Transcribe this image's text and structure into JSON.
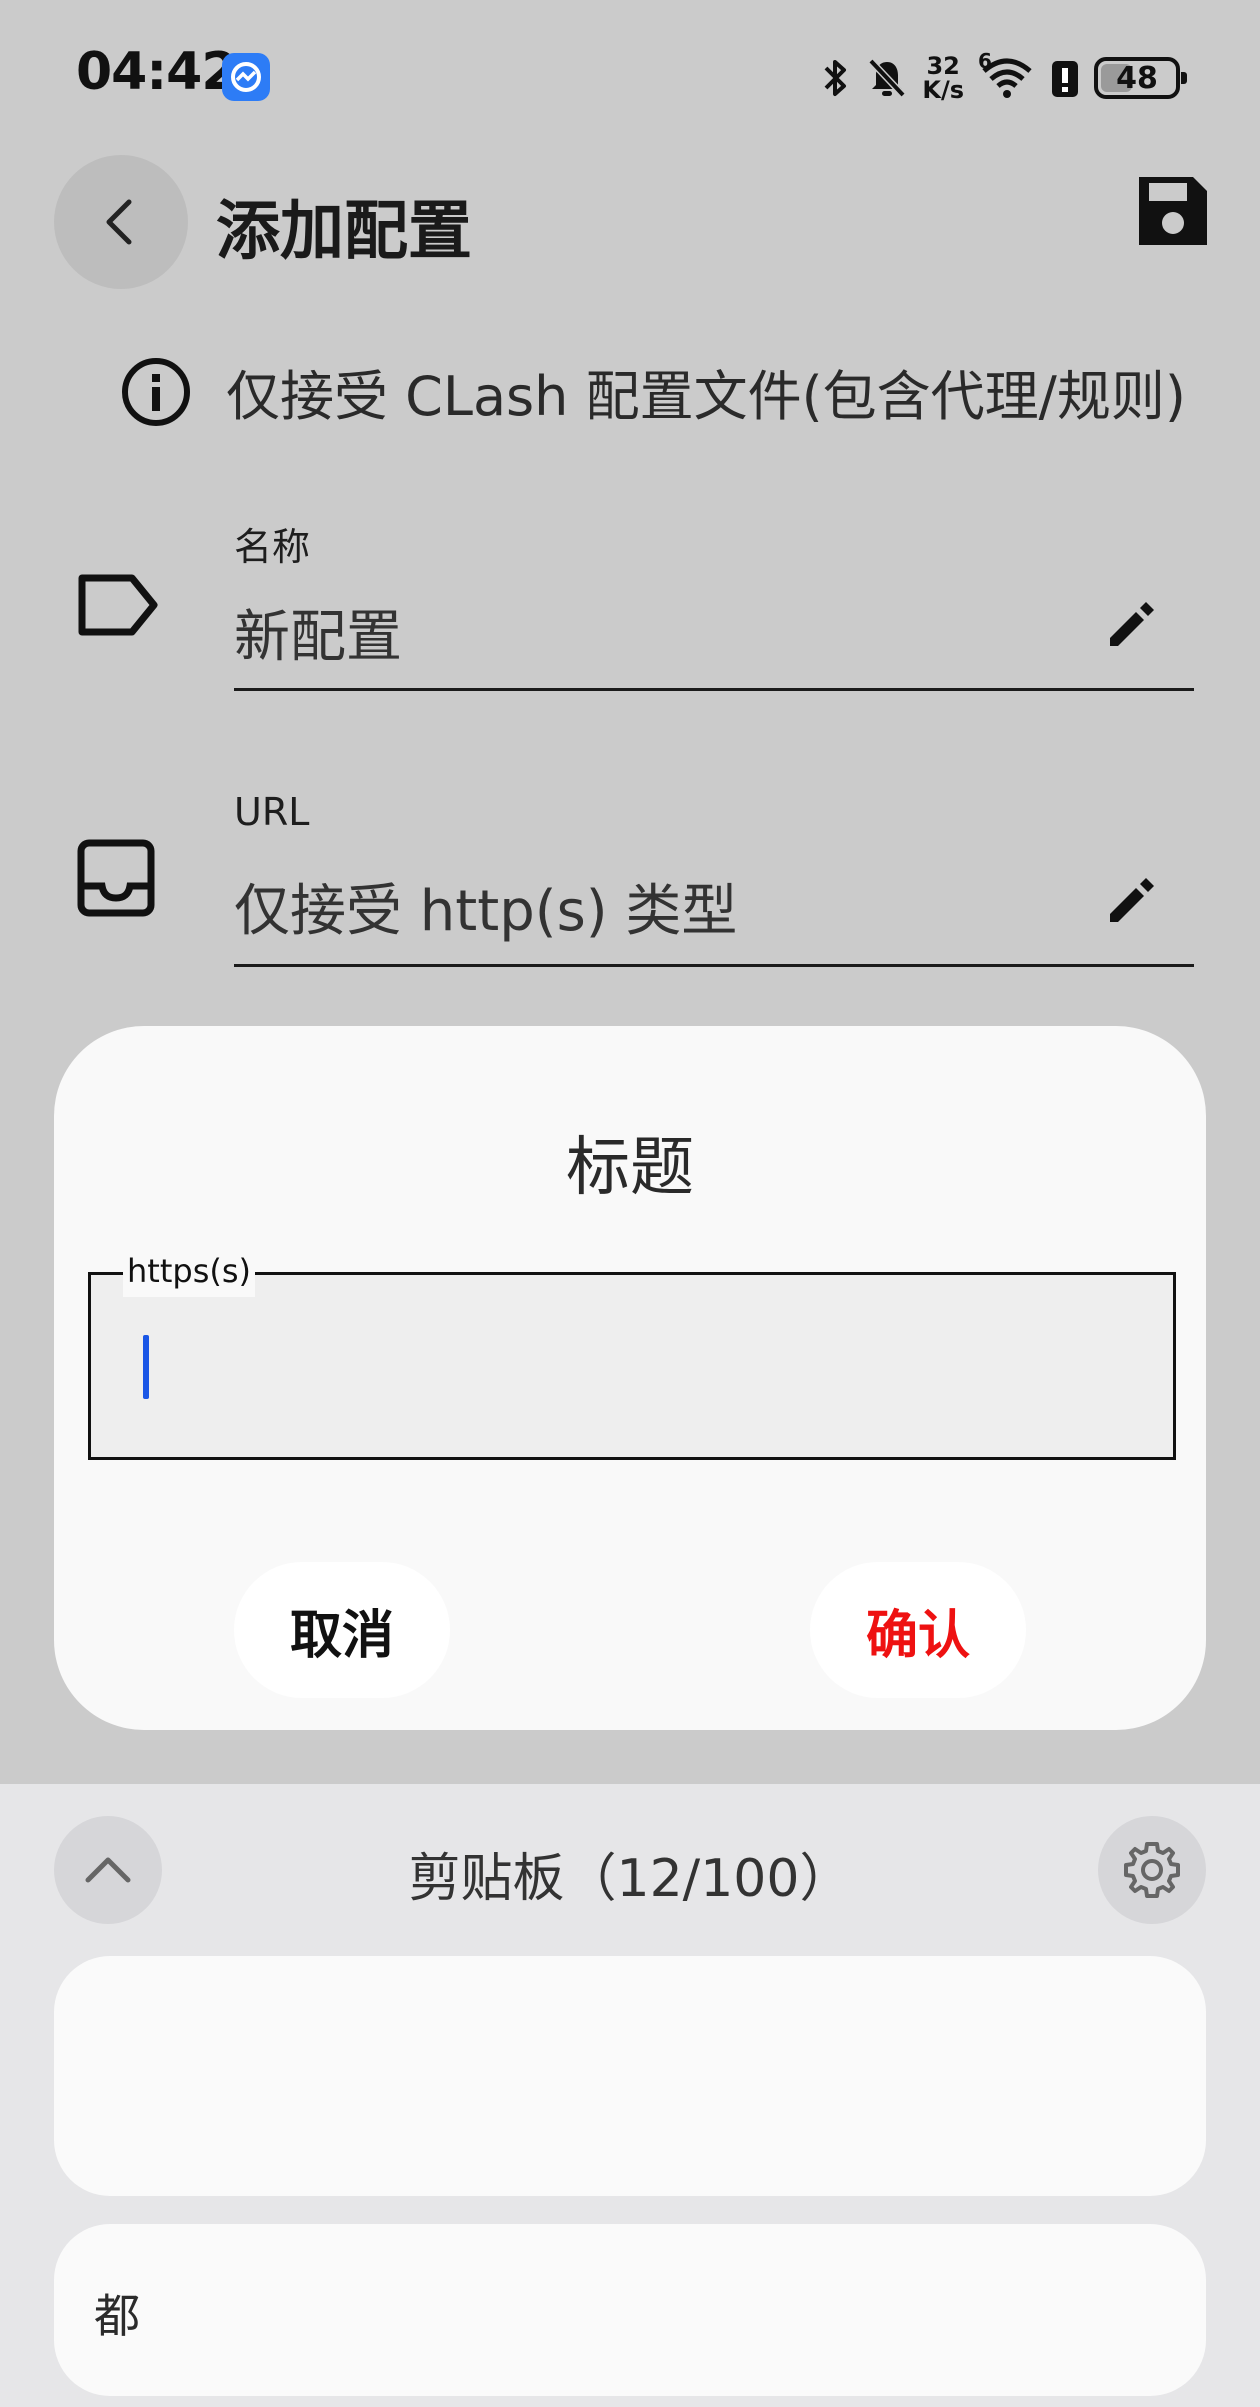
{
  "status_bar": {
    "time": "04:42",
    "net_speed_value": "32",
    "net_speed_unit": "K/s",
    "wifi_badge": "6",
    "battery": "48",
    "battery_level_percent": 48,
    "icons": [
      "app-monitor-icon",
      "bluetooth-icon",
      "bell-muted-icon",
      "wifi-icon",
      "battery-alert-icon",
      "battery-icon"
    ]
  },
  "header": {
    "title": "添加配置",
    "back_icon": "chevron-left-icon",
    "save_icon": "floppy-disk-icon"
  },
  "info": {
    "icon": "info-icon",
    "text": "仅接受 CLash 配置文件(包含代理/规则)"
  },
  "fields": {
    "name": {
      "icon": "tag-icon",
      "label": "名称",
      "value": "新配置",
      "edit_icon": "pencil-icon"
    },
    "url": {
      "icon": "inbox-icon",
      "label": "URL",
      "value": "仅接受 http(s) 类型",
      "edit_icon": "pencil-icon"
    }
  },
  "dialog": {
    "title": "标题",
    "input_label": "https(s)",
    "input_value": "",
    "cancel_label": "取消",
    "confirm_label": "确认",
    "confirm_color": "#ee1111"
  },
  "clipboard": {
    "title": "剪贴板（12/100）",
    "collapse_icon": "chevron-up-icon",
    "settings_icon": "gear-icon",
    "items": [
      {
        "text": ""
      },
      {
        "text": "都"
      }
    ]
  }
}
